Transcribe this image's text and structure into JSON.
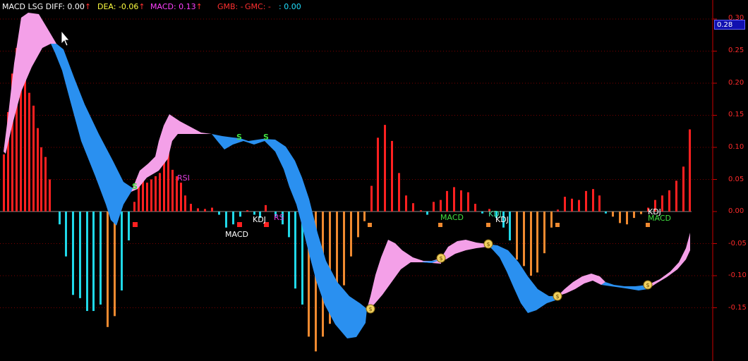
{
  "header": {
    "name": "MACD LSG",
    "diff": "DIFF: 0.00",
    "dea": "DEA: -0.06",
    "macd": "MACD: 0.13",
    "gmb": "GMB: -",
    "gmc": "GMC: -",
    "extra": ": 0.00",
    "arrow": "↑"
  },
  "axis": {
    "current_value": "0.28",
    "ticks": [
      "0.30",
      "0.25",
      "0.20",
      "0.15",
      "0.10",
      "0.05",
      "0.00",
      "-0.05",
      "-0.10",
      "-0.15"
    ]
  },
  "labels": {
    "rsi1": "RSI",
    "macd1": "MACD",
    "kdj1": "KDJ",
    "rs": "RS",
    "macd2": "MACD",
    "kdj2": "KDJ",
    "kdj3": "KDJ",
    "kdj4": "KDJ",
    "macd3": "MACD",
    "s1": "S",
    "s2": "S",
    "s3": "S"
  },
  "colors": {
    "bg": "#000000",
    "axis": "#cc0000",
    "pos_bar": "#ff2020",
    "neg_bar_cyan": "#20d8e8",
    "neg_bar_orange": "#f08a30",
    "band_pink": "#f4a0e8",
    "band_blue": "#2a90f0",
    "diff_text": "#ffffff",
    "dea_text": "#ffff40",
    "macd_text": "#ff40ff",
    "gmb_text": "#ff3030",
    "gmc_text": "#ff3030",
    "extra_text": "#20e0ff"
  },
  "chart_data": {
    "type": "bar",
    "ylim": [
      -0.22,
      0.31
    ],
    "bars": [
      {
        "x": 5,
        "v": 0.089,
        "c": "r"
      },
      {
        "x": 11,
        "v": 0.155,
        "c": "r"
      },
      {
        "x": 17,
        "v": 0.215,
        "c": "r"
      },
      {
        "x": 23,
        "v": 0.255,
        "c": "r"
      },
      {
        "x": 29,
        "v": 0.225,
        "c": "r"
      },
      {
        "x": 35,
        "v": 0.215,
        "c": "r"
      },
      {
        "x": 41,
        "v": 0.185,
        "c": "r"
      },
      {
        "x": 47,
        "v": 0.165,
        "c": "r"
      },
      {
        "x": 53,
        "v": 0.13,
        "c": "r"
      },
      {
        "x": 58,
        "v": 0.1,
        "c": "r"
      },
      {
        "x": 64,
        "v": 0.085,
        "c": "r"
      },
      {
        "x": 70,
        "v": 0.05,
        "c": "r"
      },
      {
        "x": 84,
        "v": -0.02,
        "c": "c"
      },
      {
        "x": 93,
        "v": -0.07,
        "c": "c"
      },
      {
        "x": 103,
        "v": -0.13,
        "c": "c"
      },
      {
        "x": 113,
        "v": -0.135,
        "c": "c"
      },
      {
        "x": 123,
        "v": -0.155,
        "c": "c"
      },
      {
        "x": 132,
        "v": -0.155,
        "c": "c"
      },
      {
        "x": 142,
        "v": -0.145,
        "c": "c"
      },
      {
        "x": 152,
        "v": -0.18,
        "c": "o"
      },
      {
        "x": 162,
        "v": -0.163,
        "c": "o"
      },
      {
        "x": 172,
        "v": -0.123,
        "c": "c"
      },
      {
        "x": 182,
        "v": -0.045,
        "c": "c"
      },
      {
        "x": 190,
        "v": 0.015,
        "c": "r"
      },
      {
        "x": 196,
        "v": 0.045,
        "c": "r"
      },
      {
        "x": 202,
        "v": 0.055,
        "c": "r"
      },
      {
        "x": 208,
        "v": 0.045,
        "c": "r"
      },
      {
        "x": 214,
        "v": 0.05,
        "c": "r"
      },
      {
        "x": 220,
        "v": 0.055,
        "c": "r"
      },
      {
        "x": 226,
        "v": 0.06,
        "c": "r"
      },
      {
        "x": 232,
        "v": 0.105,
        "c": "r"
      },
      {
        "x": 238,
        "v": 0.105,
        "c": "r"
      },
      {
        "x": 244,
        "v": 0.065,
        "c": "r"
      },
      {
        "x": 250,
        "v": 0.055,
        "c": "r"
      },
      {
        "x": 256,
        "v": 0.045,
        "c": "r"
      },
      {
        "x": 262,
        "v": 0.025,
        "c": "r"
      },
      {
        "x": 270,
        "v": 0.012,
        "c": "r"
      },
      {
        "x": 280,
        "v": 0.005,
        "c": "r"
      },
      {
        "x": 290,
        "v": 0.004,
        "c": "r"
      },
      {
        "x": 300,
        "v": 0.006,
        "c": "r"
      },
      {
        "x": 310,
        "v": -0.005,
        "c": "c"
      },
      {
        "x": 320,
        "v": -0.025,
        "c": "c"
      },
      {
        "x": 330,
        "v": -0.02,
        "c": "c"
      },
      {
        "x": 340,
        "v": -0.008,
        "c": "c"
      },
      {
        "x": 350,
        "v": 0.002,
        "c": "r"
      },
      {
        "x": 360,
        "v": -0.005,
        "c": "c"
      },
      {
        "x": 368,
        "v": -0.01,
        "c": "c"
      },
      {
        "x": 376,
        "v": 0.01,
        "c": "r"
      },
      {
        "x": 390,
        "v": -0.008,
        "c": "c"
      },
      {
        "x": 400,
        "v": -0.02,
        "c": "c"
      },
      {
        "x": 409,
        "v": -0.04,
        "c": "c"
      },
      {
        "x": 418,
        "v": -0.12,
        "c": "c"
      },
      {
        "x": 428,
        "v": -0.145,
        "c": "c"
      },
      {
        "x": 437,
        "v": -0.195,
        "c": "o"
      },
      {
        "x": 447,
        "v": -0.218,
        "c": "o"
      },
      {
        "x": 457,
        "v": -0.195,
        "c": "o"
      },
      {
        "x": 467,
        "v": -0.175,
        "c": "o"
      },
      {
        "x": 477,
        "v": -0.135,
        "c": "o"
      },
      {
        "x": 487,
        "v": -0.115,
        "c": "o"
      },
      {
        "x": 497,
        "v": -0.07,
        "c": "o"
      },
      {
        "x": 507,
        "v": -0.04,
        "c": "o"
      },
      {
        "x": 516,
        "v": -0.015,
        "c": "o"
      },
      {
        "x": 526,
        "v": 0.04,
        "c": "r"
      },
      {
        "x": 535,
        "v": 0.115,
        "c": "r"
      },
      {
        "x": 545,
        "v": 0.135,
        "c": "r"
      },
      {
        "x": 555,
        "v": 0.11,
        "c": "r"
      },
      {
        "x": 565,
        "v": 0.06,
        "c": "r"
      },
      {
        "x": 575,
        "v": 0.025,
        "c": "r"
      },
      {
        "x": 585,
        "v": 0.013,
        "c": "r"
      },
      {
        "x": 596,
        "v": 0.002,
        "c": "r"
      },
      {
        "x": 605,
        "v": -0.005,
        "c": "c"
      },
      {
        "x": 614,
        "v": 0.015,
        "c": "r"
      },
      {
        "x": 624,
        "v": 0.018,
        "c": "r"
      },
      {
        "x": 633,
        "v": 0.032,
        "c": "r"
      },
      {
        "x": 643,
        "v": 0.038,
        "c": "r"
      },
      {
        "x": 653,
        "v": 0.033,
        "c": "r"
      },
      {
        "x": 663,
        "v": 0.03,
        "c": "r"
      },
      {
        "x": 673,
        "v": 0.012,
        "c": "r"
      },
      {
        "x": 683,
        "v": -0.003,
        "c": "c"
      },
      {
        "x": 693,
        "v": 0.004,
        "c": "r"
      },
      {
        "x": 703,
        "v": -0.01,
        "c": "c"
      },
      {
        "x": 713,
        "v": -0.025,
        "c": "c"
      },
      {
        "x": 722,
        "v": -0.045,
        "c": "c"
      },
      {
        "x": 732,
        "v": -0.075,
        "c": "o"
      },
      {
        "x": 742,
        "v": -0.085,
        "c": "o"
      },
      {
        "x": 752,
        "v": -0.1,
        "c": "o"
      },
      {
        "x": 761,
        "v": -0.095,
        "c": "o"
      },
      {
        "x": 771,
        "v": -0.065,
        "c": "o"
      },
      {
        "x": 781,
        "v": -0.025,
        "c": "o"
      },
      {
        "x": 790,
        "v": 0.003,
        "c": "r"
      },
      {
        "x": 800,
        "v": 0.023,
        "c": "r"
      },
      {
        "x": 810,
        "v": 0.02,
        "c": "r"
      },
      {
        "x": 820,
        "v": 0.018,
        "c": "r"
      },
      {
        "x": 830,
        "v": 0.032,
        "c": "r"
      },
      {
        "x": 840,
        "v": 0.035,
        "c": "r"
      },
      {
        "x": 849,
        "v": 0.025,
        "c": "r"
      },
      {
        "x": 858,
        "v": -0.003,
        "c": "c"
      },
      {
        "x": 868,
        "v": -0.008,
        "c": "o"
      },
      {
        "x": 878,
        "v": -0.018,
        "c": "o"
      },
      {
        "x": 888,
        "v": -0.02,
        "c": "o"
      },
      {
        "x": 898,
        "v": -0.01,
        "c": "o"
      },
      {
        "x": 908,
        "v": -0.004,
        "c": "o"
      },
      {
        "x": 918,
        "v": 0.006,
        "c": "r"
      },
      {
        "x": 928,
        "v": 0.018,
        "c": "r"
      },
      {
        "x": 938,
        "v": 0.025,
        "c": "r"
      },
      {
        "x": 948,
        "v": 0.033,
        "c": "r"
      },
      {
        "x": 958,
        "v": 0.048,
        "c": "r"
      },
      {
        "x": 968,
        "v": 0.07,
        "c": "r"
      },
      {
        "x": 977,
        "v": 0.128,
        "c": "r"
      }
    ]
  }
}
